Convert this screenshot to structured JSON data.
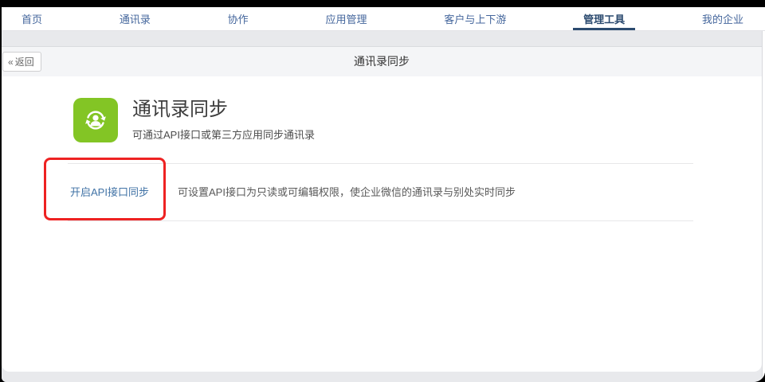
{
  "nav": {
    "items": [
      {
        "label": "首页"
      },
      {
        "label": "通讯录"
      },
      {
        "label": "协作"
      },
      {
        "label": "应用管理"
      },
      {
        "label": "客户与上下游"
      },
      {
        "label": "管理工具"
      },
      {
        "label": "我的企业"
      }
    ],
    "active_item": "管理工具"
  },
  "subheader": {
    "back_icon": "«",
    "back_label": "返回",
    "title": "通讯录同步"
  },
  "main": {
    "feature": {
      "icon": "contact-sync-icon",
      "icon_color": "#83c525",
      "title": "通讯录同步",
      "subtitle": "可通过API接口或第三方应用同步通讯录"
    },
    "sync_row": {
      "link_label": "开启API接口同步",
      "description": "可设置API接口为只读或可编辑权限，使企业微信的通讯录与别处实时同步"
    },
    "annotation": {
      "type": "red-highlight-box",
      "color": "#ee2222",
      "target": "开启API接口同步"
    }
  },
  "colors": {
    "nav_link": "#44669c",
    "nav_active": "#2b4a6f",
    "text_link": "#4173a6",
    "accent_green": "#83c525",
    "annotation_red": "#ee2222"
  }
}
